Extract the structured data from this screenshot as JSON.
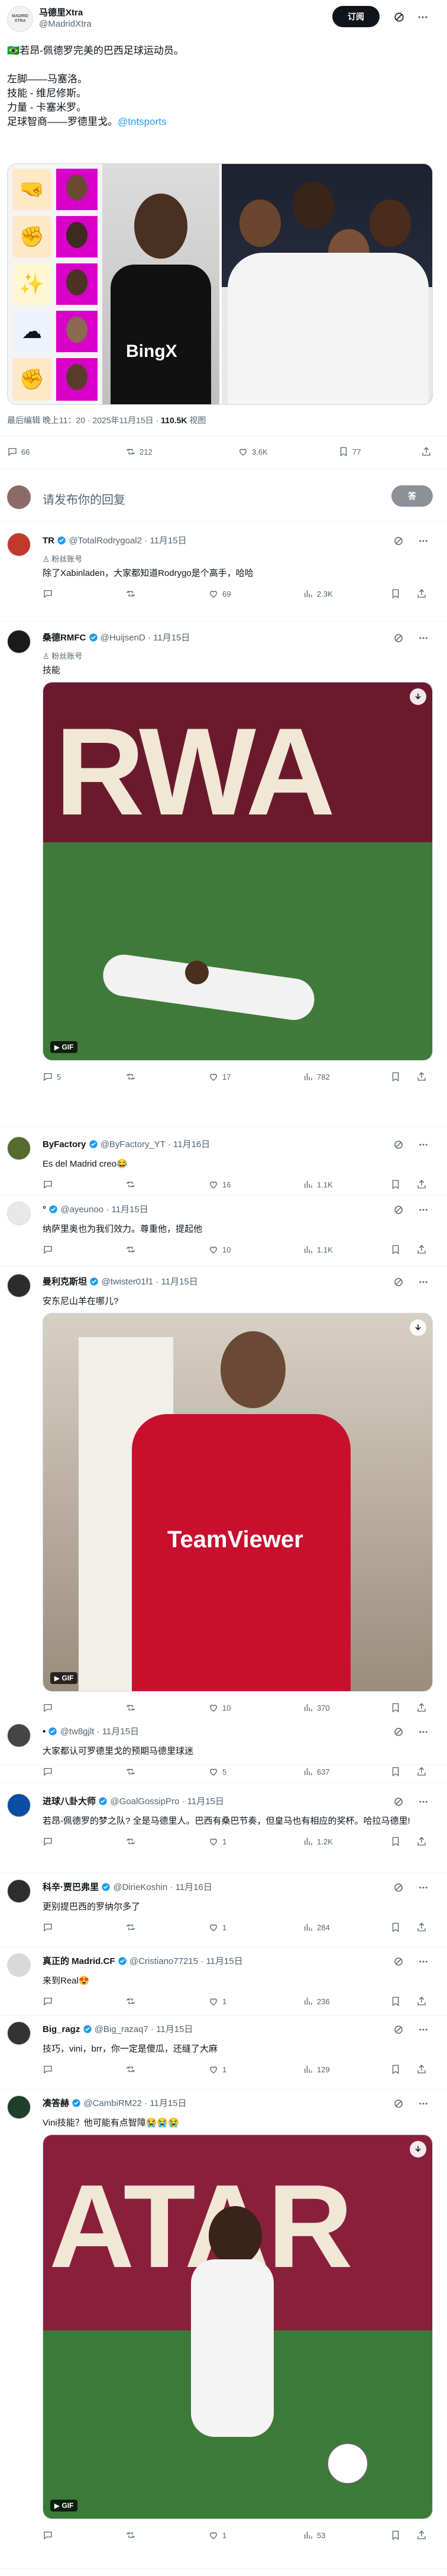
{
  "colors": {
    "accent": "#1d9bf0",
    "verified_gold": "#e2b719",
    "text": "#0f1419",
    "muted": "#536471"
  },
  "post": {
    "author_name": "马德里Xtra",
    "author_handle": "@MadridXtra",
    "follow_label": "订阅",
    "avatar_text": "MADRID XTRA",
    "line1": "🇧🇷若昂-佩德罗完美的巴西足球运动员。",
    "line2": "左脚——马塞洛。",
    "line3": "技能 - 维尼修斯。",
    "line4": "力量 - 卡塞米罗。",
    "line5_prefix": "足球智商——罗德里戈。",
    "line5_link": "@tntsports",
    "image_left_text": "BingX",
    "edit_meta_prefix": "最后编辑 晚上11：20 · 2025年11月15日 · ",
    "views_count": "110.5K",
    "views_label": " 视图",
    "stats": {
      "replies": "66",
      "retweets": "212",
      "likes": "3.6K",
      "bookmarks": "77"
    }
  },
  "compose": {
    "placeholder": "请发布你的回复",
    "button_label": "答"
  },
  "replies": [
    {
      "name": "TR",
      "handle": "@TotalRodrygoal2",
      "time": "· 11月15日",
      "badge": "粉丝账号",
      "text": "除了Xabinladen，大家都知道Rodrygo是个高手，哈哈",
      "stats": {
        "r": "",
        "rt": "",
        "l": "69",
        "v": "2.3K"
      }
    },
    {
      "name": "桑德RMFC",
      "handle": "@HuijsenD",
      "time": "· 11月15日",
      "badge": "粉丝账号",
      "text": "技能",
      "stats": {
        "r": "5",
        "rt": "",
        "l": "17",
        "v": "782"
      },
      "media_text": "RWA",
      "gif_label": "GIF"
    },
    {
      "name": "ByFactory",
      "handle": "@ByFactory_YT",
      "time": "· 11月16日",
      "text": "Es del Madrid creo😂",
      "stats": {
        "r": "",
        "rt": "",
        "l": "16",
        "v": "1.1K"
      }
    },
    {
      "name": "°",
      "handle": "@ayeunoo",
      "time": "· 11月15日",
      "text": "纳萨里奥也为我们效力。尊重他，提起他",
      "stats": {
        "r": "",
        "rt": "",
        "l": "10",
        "v": "1.1K"
      }
    },
    {
      "name": "曼利克斯坦",
      "handle": "@twister01f1",
      "time": "· 11月15日",
      "text": "安东尼山羊在哪儿?",
      "stats": {
        "r": "",
        "rt": "",
        "l": "10",
        "v": "370"
      },
      "media_text": "TeamViewer",
      "gif_label": "GIF"
    },
    {
      "name": "•",
      "handle": "@tw8gjlt",
      "time": "· 11月15日",
      "text": "大家都认可罗德里戈的预期马德里球迷",
      "stats": {
        "r": "",
        "rt": "",
        "l": "5",
        "v": "637"
      }
    },
    {
      "name": "进球八卦大师",
      "handle": "@GoalGossipPro",
      "time": "· 11月15日",
      "text": "若昂-佩德罗的梦之队? 全是马德里人。巴西有桑巴节奏，但皇马也有相应的奖杯。哈拉马德里!",
      "stats": {
        "r": "",
        "rt": "",
        "l": "1",
        "v": "1.2K"
      }
    },
    {
      "name": "科辛·贾巴弗里",
      "handle": "@DirieKoshin",
      "time": "· 11月16日",
      "text": "更别提巴西的罗纳尔多了",
      "stats": {
        "r": "",
        "rt": "",
        "l": "1",
        "v": "284"
      }
    },
    {
      "name": "真正的 Madrid.CF",
      "handle": "@Cristiano77215",
      "time": "· 11月15日",
      "text": "来到Real😍",
      "stats": {
        "r": "",
        "rt": "",
        "l": "1",
        "v": "236"
      }
    },
    {
      "name": "Big_ragz",
      "handle": "@Big_razaq7",
      "time": "· 11月15日",
      "text": "技巧，vini，brr，你一定是傻瓜，还缝了大麻",
      "stats": {
        "r": "",
        "rt": "",
        "l": "1",
        "v": "129"
      }
    },
    {
      "name": "凑答赫",
      "handle": "@CambiRM22",
      "time": "· 11月15日",
      "text": "Vini技能？他可能有点智障😭😭😭",
      "stats": {
        "r": "",
        "rt": "",
        "l": "1",
        "v": "53"
      },
      "media_text": "ATAR",
      "gif_label": "GIF"
    }
  ]
}
